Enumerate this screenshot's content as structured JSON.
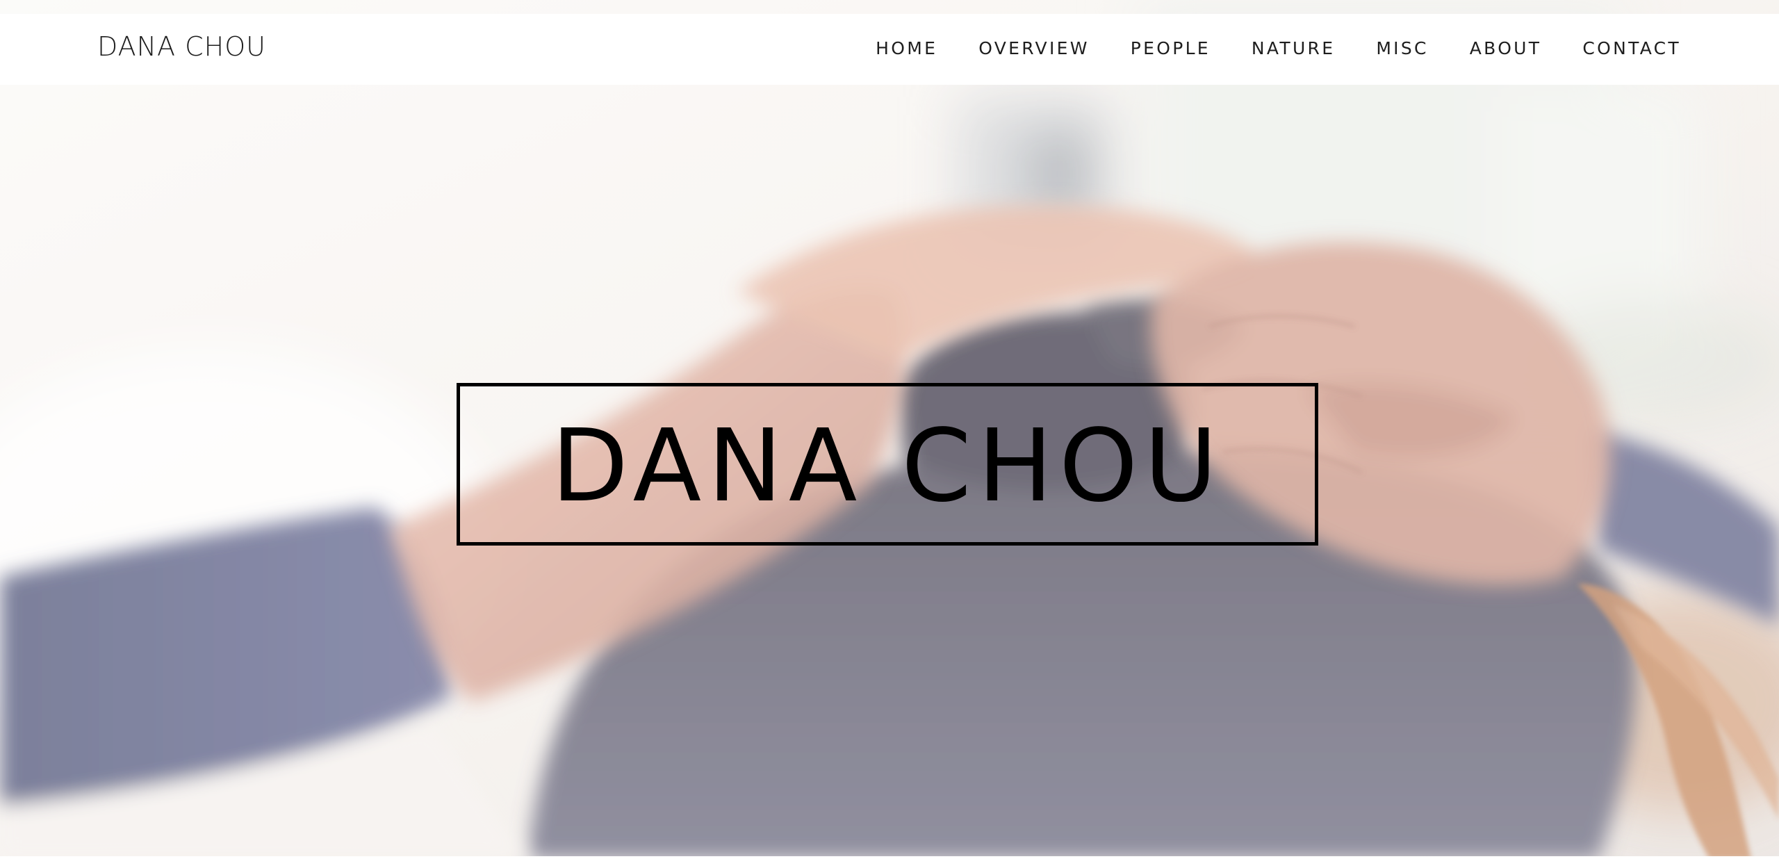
{
  "site": {
    "brand": "DANA CHOU"
  },
  "nav": {
    "items": [
      {
        "label": "HOME"
      },
      {
        "label": "OVERVIEW"
      },
      {
        "label": "PEOPLE"
      },
      {
        "label": "NATURE"
      },
      {
        "label": "MISC"
      },
      {
        "label": "ABOUT"
      },
      {
        "label": "CONTACT"
      }
    ]
  },
  "hero": {
    "title": "DANA CHOU"
  },
  "colors": {
    "text": "#1d1d1d",
    "title_border": "#000000",
    "nav_background": "#ffffff"
  }
}
